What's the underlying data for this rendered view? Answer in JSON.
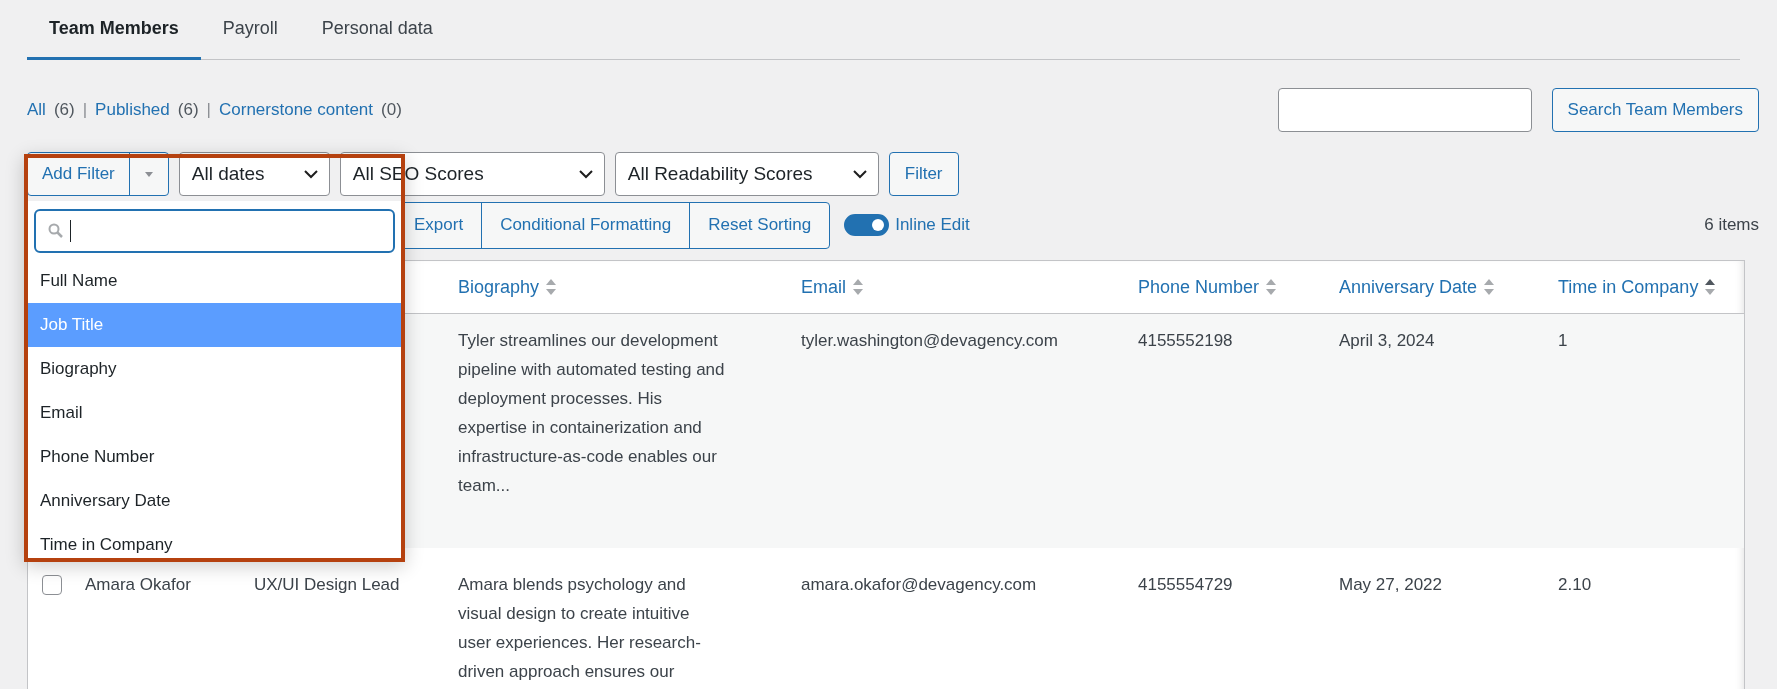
{
  "tabs": [
    {
      "label": "Team Members",
      "selected": true
    },
    {
      "label": "Payroll",
      "selected": false
    },
    {
      "label": "Personal data",
      "selected": false
    }
  ],
  "views": [
    {
      "label": "All",
      "count": "(6)"
    },
    {
      "separator": "|",
      "label": "Published",
      "count": "(6)"
    },
    {
      "separator": "|",
      "label": "Cornerstone content",
      "count": "(0)"
    }
  ],
  "search": {
    "button": "Search Team Members"
  },
  "filters": {
    "add_filter": "Add Filter",
    "selects": [
      "All dates",
      "All SEO Scores",
      "All Readability Scores"
    ],
    "button": "Filter"
  },
  "actions": [
    "Export",
    "Conditional Formatting",
    "Reset Sorting"
  ],
  "inline_edit": {
    "label": "Inline Edit",
    "on": true
  },
  "item_count": "6 items",
  "table": {
    "columns": [
      {
        "label": "Biography",
        "sorted": false
      },
      {
        "label": "Email",
        "sorted": false
      },
      {
        "label": "Phone Number",
        "sorted": false
      },
      {
        "label": "Anniversary Date",
        "sorted": false
      },
      {
        "label": "Time in Company",
        "sorted": true
      }
    ],
    "rows": [
      {
        "biography": "Tyler streamlines our development pipeline with automated testing and deployment processes. His expertise in containerization and infrastructure-as-code enables our team...",
        "email": "tyler.washington@devagency.com",
        "phone": "4155552198",
        "anniversary": "April 3, 2024",
        "time": "1"
      },
      {
        "checked": false,
        "name": "Amara Okafor",
        "job_title": "UX/UI Design Lead",
        "biography": "Amara blends psychology and visual design to create intuitive user experiences. Her research-driven approach ensures our",
        "email": "amara.okafor@devagency.com",
        "phone": "4155554729",
        "anniversary": "May 27, 2022",
        "time": "2.10"
      }
    ]
  },
  "filter_menu": {
    "items": [
      {
        "label": "Full Name",
        "selected": false
      },
      {
        "label": "Job Title",
        "selected": true
      },
      {
        "label": "Biography",
        "selected": false
      },
      {
        "label": "Email",
        "selected": false
      },
      {
        "label": "Phone Number",
        "selected": false
      },
      {
        "label": "Anniversary Date",
        "selected": false
      },
      {
        "label": "Time in Company",
        "selected": false
      }
    ]
  }
}
